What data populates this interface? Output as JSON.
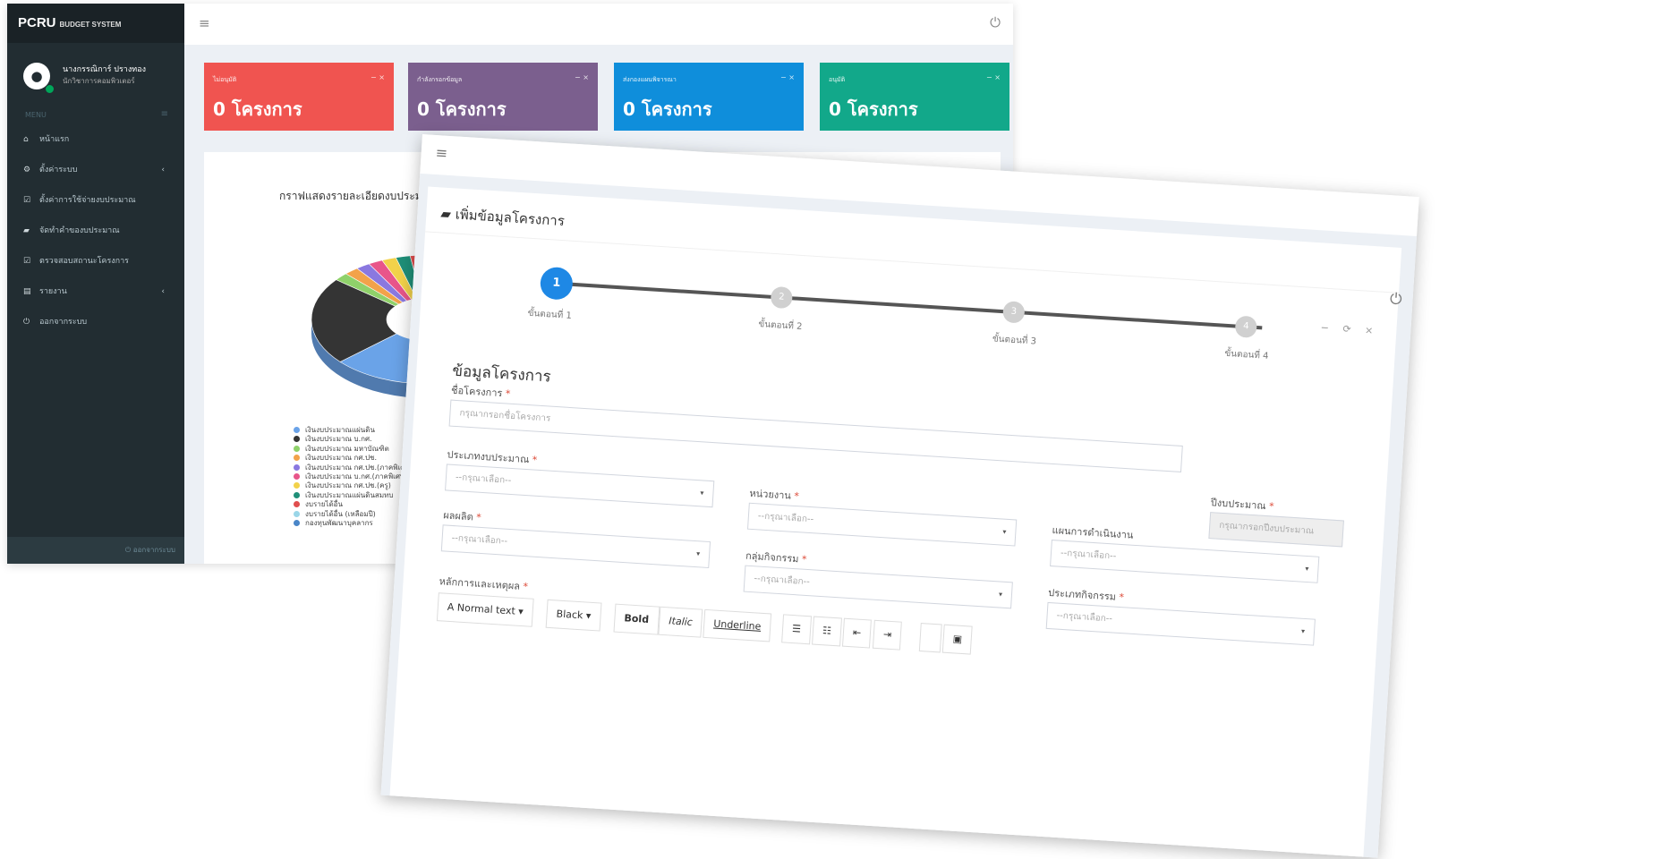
{
  "dashboard": {
    "logo": "PCRU",
    "logo_sub": "BUDGET SYSTEM",
    "user": {
      "name": "นางกรรณิการ์ ปรางทอง",
      "role": "นักวิชาการคอมพิวเตอร์"
    },
    "menu_header": "MENU",
    "nav": [
      {
        "icon": "home-icon",
        "glyph": "⌂",
        "label": "หน้าแรก",
        "caret": ""
      },
      {
        "icon": "gears-icon",
        "glyph": "⚙",
        "label": "ตั้งค่าระบบ",
        "caret": "‹"
      },
      {
        "icon": "check-square-icon",
        "glyph": "☑",
        "label": "ตั้งค่าการใช้จ่ายงบประมาณ",
        "caret": ""
      },
      {
        "icon": "folder-open-icon",
        "glyph": "▰",
        "label": "จัดทำคำของบประมาณ",
        "caret": ""
      },
      {
        "icon": "check-square-icon",
        "glyph": "☑",
        "label": "ตรวจสอบสถานะโครงการ",
        "caret": ""
      },
      {
        "icon": "bar-chart-icon",
        "glyph": "▤",
        "label": "รายงาน",
        "caret": "‹"
      },
      {
        "icon": "power-icon",
        "glyph": "⏻",
        "label": "ออกจากระบบ",
        "caret": ""
      }
    ],
    "footer": "⏻ ออกจากระบบ",
    "stat_boxes": [
      {
        "label": "ไม่อนุมัติ",
        "value": "0 โครงการ",
        "color": "#f05450"
      },
      {
        "label": "กำลังกรอกข้อมูล",
        "value": "0 โครงการ",
        "color": "#7b5f8e"
      },
      {
        "label": "ส่งกองแผนพิจารณา",
        "value": "0 โครงการ",
        "color": "#0f8edb"
      },
      {
        "label": "อนุมัติ",
        "value": "0 โครงการ",
        "color": "#12a88a"
      }
    ],
    "chart_title": "กราฟแสดงรายละเอียดงบประมาณ",
    "chart_data": {
      "type": "pie",
      "categories": [
        "เงินงบประมาณแผ่นดิน",
        "เงินงบประมาณ บ.กศ.",
        "เงินงบประมาณ มหาบัณฑิต",
        "เงินงบประมาณ กศ.ปช.",
        "เงินงบประมาณ กศ.ปช.(ภาคพิเศษ)",
        "เงินงบประมาณ บ.กศ.(ภาคพิเศษ)",
        "เงินงบประมาณ กศ.ปช.(ครู)",
        "เงินงบประมาณแผ่นดินสมทบ",
        "งบรายได้อื่น",
        "งบรายได้อื่น (เหลือมปี)",
        "กองทุนพัฒนาบุคลากร"
      ],
      "values": [
        58,
        22,
        2,
        2,
        2,
        2,
        2,
        2,
        2,
        3,
        3
      ],
      "colors": [
        "#6aa3e8",
        "#343434",
        "#8fd16a",
        "#f2a24a",
        "#8a78e0",
        "#e8558a",
        "#f2d24a",
        "#1f8f78",
        "#e04e4e",
        "#9ad6e8",
        "#4a86c8"
      ]
    }
  },
  "form": {
    "title": "เพิ่มข้อมูลโครงการ",
    "box_tools": "− ⟳ ×",
    "steps": [
      "ขั้นตอนที่ 1",
      "ขั้นตอนที่ 2",
      "ขั้นตอนที่ 3",
      "ขั้นตอนที่ 4"
    ],
    "step_numbers": [
      "1",
      "2",
      "3",
      "4"
    ],
    "section_title": "ข้อมูลโครงการ",
    "required_mark": "*",
    "fields": {
      "project_name": {
        "label": "ชื่อโครงการ",
        "placeholder": "กรุณากรอกชื่อโครงการ"
      },
      "budget_type": {
        "label": "ประเภทงบประมาณ",
        "value": "--กรุณาเลือก--"
      },
      "fiscal_year": {
        "label": "ปีงบประมาณ",
        "placeholder": "กรุณากรอกปีงบประมาณ"
      },
      "department": {
        "label": "หน่วยงาน",
        "value": "--กรุณาเลือก--"
      },
      "plan": {
        "label": "แผนการดำเนินงาน",
        "value": "--กรุณาเลือก--"
      },
      "output": {
        "label": "ผลผลิต",
        "value": "--กรุณาเลือก--"
      },
      "activity_group": {
        "label": "กลุ่มกิจกรรม",
        "value": "--กรุณาเลือก--"
      },
      "activity_type": {
        "label": "ประเภทกิจกรรม",
        "value": "--กรุณาเลือก--"
      },
      "rationale": {
        "label": "หลักการและเหตุผล"
      }
    },
    "toolbar": {
      "text_style": "A Normal text ▾",
      "color": "Black ▾",
      "bold": "Bold",
      "italic": "Italic",
      "underline": "Underline",
      "list_ul": "☰",
      "list_ol": "☷",
      "outdent": "⇤",
      "indent": "⇥",
      "image": "▣"
    }
  }
}
